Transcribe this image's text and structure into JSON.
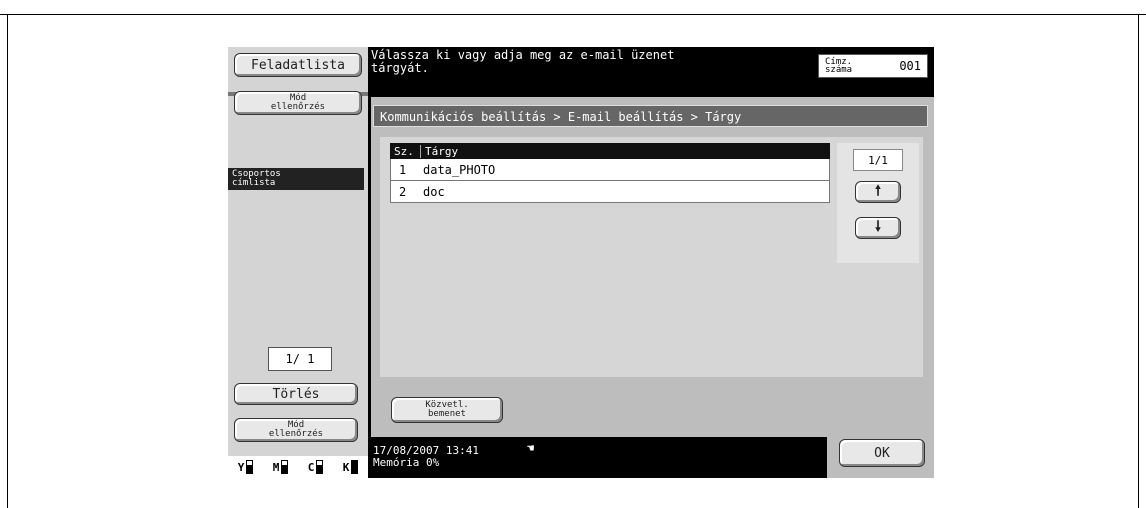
{
  "left_panel": {
    "job_list_label": "Feladatlista",
    "mode_check_label": "Mód\nellenőrzés",
    "group_address_label": "Csoportos\ncímlista",
    "page_indicator": "1/  1",
    "delete_label": "Törlés",
    "mode_check_bottom_label": "Mód\nellenőrzés",
    "toner": [
      "Y",
      "M",
      "C",
      "K"
    ]
  },
  "header": {
    "message": "Válassza ki vagy adja meg az e-mail üzenet\ntárgyát.",
    "address_count_label": "Címz.\nszáma",
    "address_count_value": "001"
  },
  "breadcrumb": "Kommunikációs beállítás > E-mail beállítás > Tárgy",
  "table": {
    "columns": [
      "Sz.",
      "Tárgy"
    ],
    "rows": [
      {
        "no": "1",
        "subject": "data_PHOTO"
      },
      {
        "no": "2",
        "subject": "doc"
      }
    ],
    "page": "1/1"
  },
  "direct_input_label": "Közvetl.\nbemenet",
  "status": {
    "date_time": "17/08/2007    13:41\nMemória         0%"
  },
  "ok_label": "OK",
  "icons": {
    "up": "arrow-up-icon",
    "down": "arrow-down-icon",
    "status": "hand-icon"
  }
}
